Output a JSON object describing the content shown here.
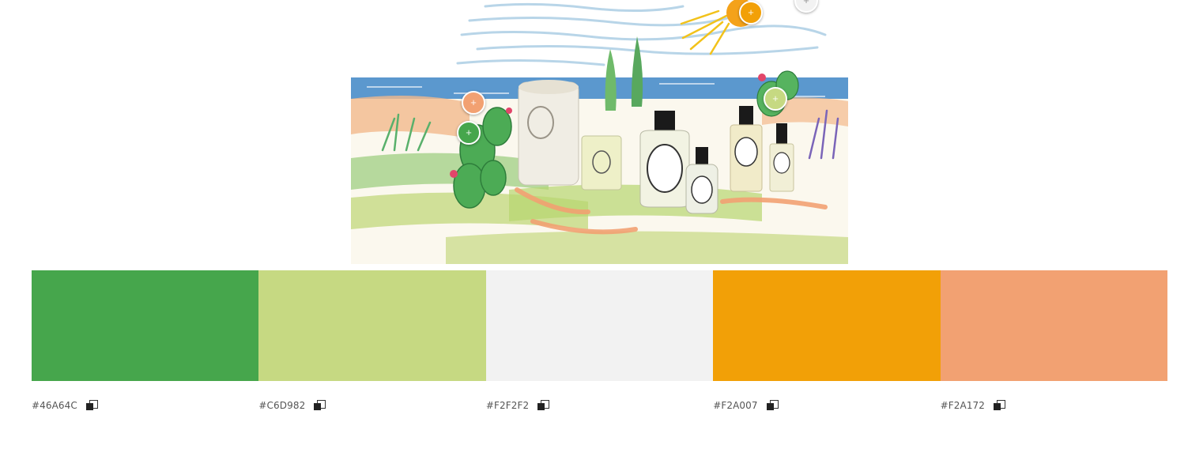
{
  "hero_image": {
    "alt": "",
    "markers": [
      {
        "color": "#F2A007",
        "glyph": "+"
      },
      {
        "color": "#F2F2F2",
        "glyph": "+"
      },
      {
        "color": "#F2A172",
        "glyph": "+"
      },
      {
        "color": "#46A64C",
        "glyph": "+"
      },
      {
        "color": "#C6D982",
        "glyph": "+"
      }
    ]
  },
  "palette": {
    "colors": [
      {
        "hex": "#46A64C"
      },
      {
        "hex": "#C6D982"
      },
      {
        "hex": "#F2F2F2"
      },
      {
        "hex": "#F2A007"
      },
      {
        "hex": "#F2A172"
      }
    ],
    "copy_icon": "copy-icon"
  }
}
